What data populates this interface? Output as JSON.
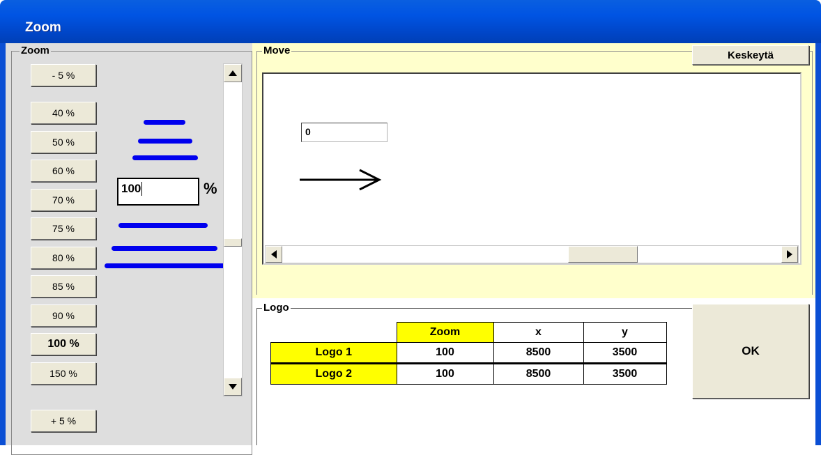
{
  "window": {
    "title": "Zoom"
  },
  "zoom_group": {
    "legend": "Zoom",
    "minus_button": "- 5 %",
    "plus_button": "+ 5 %",
    "presets": [
      "40 %",
      "50 %",
      "60 %",
      "70 %",
      "75 %",
      "80 %",
      "85 %",
      "90 %",
      "100 %",
      "150 %"
    ],
    "selected_preset": "100 %",
    "zoom_value": "100",
    "percent_sign": "%"
  },
  "move_group": {
    "legend": "Move",
    "cancel_button": "Keskeytä",
    "offset_value": "0"
  },
  "logo_group": {
    "legend": "Logo",
    "columns": [
      "Zoom",
      "x",
      "y"
    ],
    "rows": [
      {
        "label": "Logo 1",
        "zoom": "100",
        "x": "8500",
        "y": "3500"
      },
      {
        "label": "Logo 2",
        "zoom": "100",
        "x": "8500",
        "y": "3500"
      }
    ],
    "ok_button": "OK"
  },
  "colors": {
    "titlebar": "#0054e3",
    "zoom_panel_bg": "#dedede",
    "move_panel_bg": "#ffffcc",
    "highlight_yellow": "#ffff00",
    "zoom_lines": "#0000ee"
  }
}
